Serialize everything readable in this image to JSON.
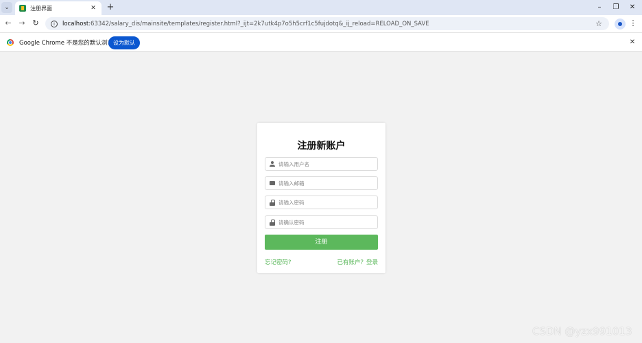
{
  "browser": {
    "tab": {
      "title": "注册界面"
    },
    "address": {
      "host": "localhost",
      "rest": ":63342/salary_dis/mainsite/templates/register.html?_ijt=2k7utk4p7o5h5crf1c5fujdotq&_ij_reload=RELOAD_ON_SAVE"
    },
    "infobar": {
      "message": "Google Chrome 不是您的默认浏览器",
      "button_label": "设为默认"
    }
  },
  "form": {
    "title": "注册新账户",
    "username_placeholder": "请输入用户名",
    "email_placeholder": "请输入邮箱",
    "password_placeholder": "请输入密码",
    "confirm_placeholder": "请确认密码",
    "submit_label": "注册",
    "forgot_link": "忘记密码?",
    "login_link": "已有账户？登录"
  },
  "watermark": "CSDN @yzx991013",
  "colors": {
    "accent": "#5cb85c",
    "chrome_blue": "#0b57d0"
  }
}
